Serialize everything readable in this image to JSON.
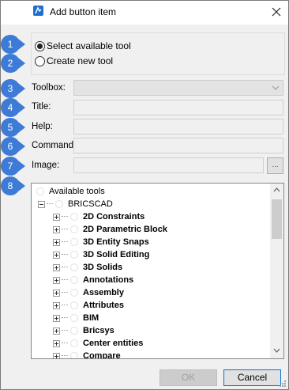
{
  "dialog": {
    "title": "Add button item",
    "close_icon": "close-icon",
    "app_icon": "bricscad-icon"
  },
  "options": {
    "select_available": "Select available tool",
    "create_new": "Create new tool",
    "selected": "select_available"
  },
  "fields": {
    "toolbox_label": "Toolbox:",
    "title_label": "Title:",
    "help_label": "Help:",
    "command_label": "Command:",
    "image_label": "Image:",
    "browse_label": "..."
  },
  "callouts": [
    "1",
    "2",
    "3",
    "4",
    "5",
    "6",
    "7",
    "8"
  ],
  "tree": {
    "root": "Available tools",
    "app": "BRICSCAD",
    "items": [
      "2D Constraints",
      "2D Parametric Block",
      "3D Entity Snaps",
      "3D Solid Editing",
      "3D Solids",
      "Annotations",
      "Assembly",
      "Attributes",
      "BIM",
      "Bricsys",
      "Center entities",
      "Compare"
    ]
  },
  "buttons": {
    "ok": "OK",
    "cancel": "Cancel"
  },
  "colors": {
    "callout": "#3d7bd6",
    "accent": "#0078d7"
  }
}
